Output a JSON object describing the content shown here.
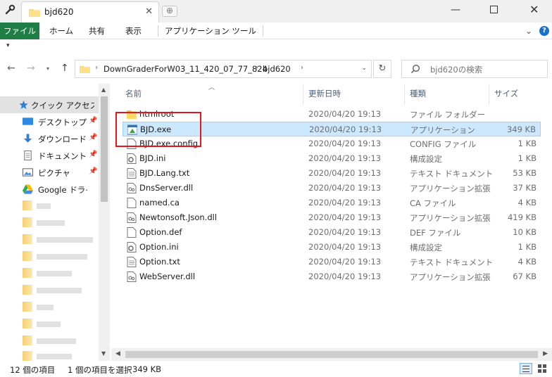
{
  "window": {
    "tab_title": "bjd620"
  },
  "ribbon": {
    "tabs": [
      "ファイル",
      "ホーム",
      "共有",
      "表示",
      "アプリケーション ツール"
    ],
    "help_label": "?"
  },
  "address": {
    "segments": [
      "DownGraderForW03_11_420_07_77_824",
      "bjd620"
    ],
    "search_placeholder": "bjd620の検索"
  },
  "nav_pane": {
    "items": [
      {
        "label": "クイック アクセス",
        "icon": "star-icon"
      },
      {
        "label": "デスクトップ",
        "icon": "desktop-icon"
      },
      {
        "label": "ダウンロード",
        "icon": "download-icon"
      },
      {
        "label": "ドキュメント",
        "icon": "document-icon"
      },
      {
        "label": "ピクチャ",
        "icon": "picture-icon"
      },
      {
        "label": "Google ドライブ",
        "icon": "google-drive-icon"
      }
    ]
  },
  "columns": {
    "name": "名前",
    "date": "更新日時",
    "type": "種類",
    "size": "サイズ"
  },
  "files": [
    {
      "name": "htmlroot",
      "date": "2020/04/20 19:13",
      "type": "ファイル フォルダー",
      "size": "",
      "icon": "folder-icon"
    },
    {
      "name": "BJD.exe",
      "date": "2020/04/20 19:13",
      "type": "アプリケーション",
      "size": "349 KB",
      "icon": "exe-icon",
      "selected": true
    },
    {
      "name": "BJD.exe.config",
      "date": "2020/04/20 19:13",
      "type": "CONFIG ファイル",
      "size": "1 KB",
      "icon": "file-icon"
    },
    {
      "name": "BJD.ini",
      "date": "2020/04/20 19:13",
      "type": "構成設定",
      "size": "1 KB",
      "icon": "settings-file-icon"
    },
    {
      "name": "BJD.Lang.txt",
      "date": "2020/04/20 19:13",
      "type": "テキスト ドキュメント",
      "size": "53 KB",
      "icon": "text-file-icon"
    },
    {
      "name": "DnsServer.dll",
      "date": "2020/04/20 19:13",
      "type": "アプリケーション拡張",
      "size": "37 KB",
      "icon": "dll-icon"
    },
    {
      "name": "named.ca",
      "date": "2020/04/20 19:13",
      "type": "CA ファイル",
      "size": "4 KB",
      "icon": "file-icon"
    },
    {
      "name": "Newtonsoft.Json.dll",
      "date": "2020/04/20 19:13",
      "type": "アプリケーション拡張",
      "size": "419 KB",
      "icon": "dll-icon"
    },
    {
      "name": "Option.def",
      "date": "2020/04/20 19:13",
      "type": "DEF ファイル",
      "size": "10 KB",
      "icon": "file-icon"
    },
    {
      "name": "Option.ini",
      "date": "2020/04/20 19:13",
      "type": "構成設定",
      "size": "1 KB",
      "icon": "settings-file-icon"
    },
    {
      "name": "Option.txt",
      "date": "2020/04/20 19:13",
      "type": "テキスト ドキュメント",
      "size": "4 KB",
      "icon": "text-file-icon"
    },
    {
      "name": "WebServer.dll",
      "date": "2020/04/20 19:13",
      "type": "アプリケーション拡張",
      "size": "67 KB",
      "icon": "dll-icon"
    }
  ],
  "status": {
    "item_count": "12 個の項目",
    "selected": "1 個の項目を選択",
    "selected_size": "349 KB"
  },
  "colors": {
    "file_tab": "#1e7e45",
    "selection": "#cce8ff",
    "highlight_box": "#e3161e"
  }
}
